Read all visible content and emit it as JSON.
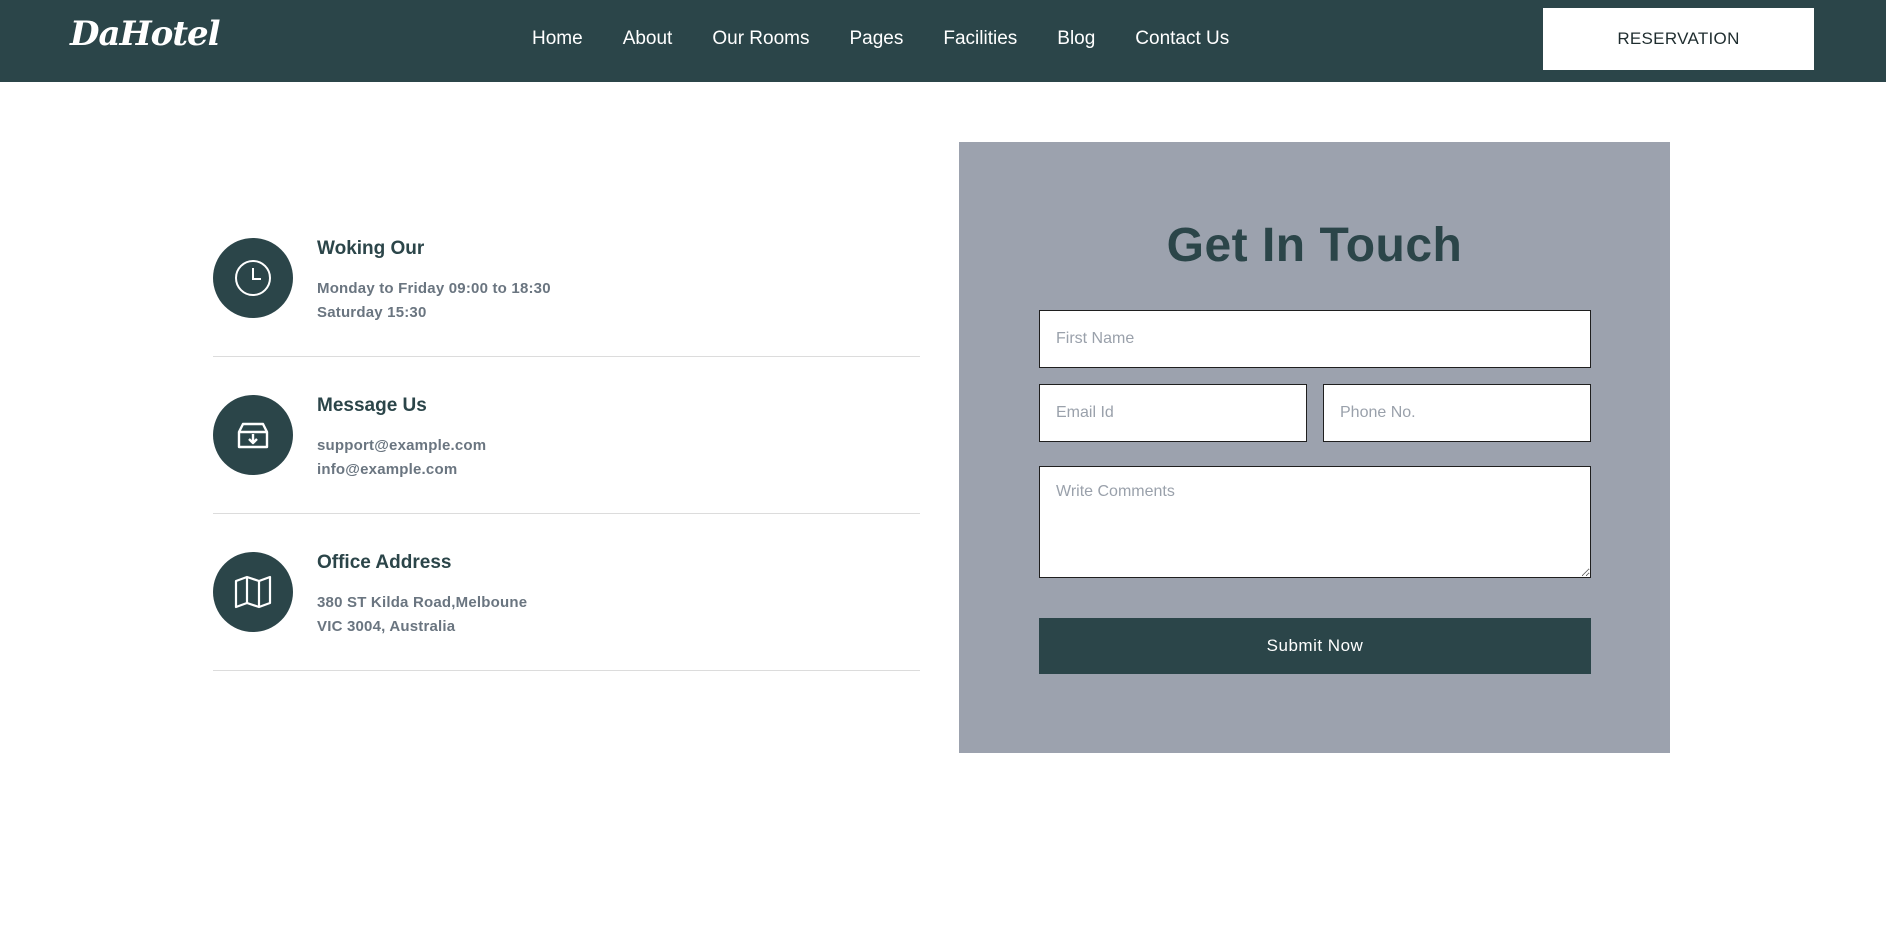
{
  "header": {
    "logo": "DaHotel",
    "nav": [
      "Home",
      "About",
      "Our Rooms",
      "Pages",
      "Facilities",
      "Blog",
      "Contact Us"
    ],
    "reservation_label": "RESERVATION"
  },
  "info": [
    {
      "icon": "clock-icon",
      "title": "Woking Our",
      "lines": [
        "Monday to Friday 09:00 to 18:30",
        "Saturday 15:30"
      ]
    },
    {
      "icon": "archive-icon",
      "title": "Message Us",
      "lines": [
        "support@example.com",
        "info@example.com"
      ]
    },
    {
      "icon": "map-icon",
      "title": "Office Address",
      "lines": [
        "380 ST Kilda Road,Melboune",
        "VIC 3004, Australia"
      ]
    }
  ],
  "form": {
    "title": "Get In Touch",
    "first_name_placeholder": "First Name",
    "email_placeholder": "Email Id",
    "phone_placeholder": "Phone No.",
    "comments_placeholder": "Write Comments",
    "submit_label": "Submit Now"
  },
  "colors": {
    "primary": "#2b4549",
    "panel": "#9ca2ae",
    "muted_text": "#6a7580"
  }
}
